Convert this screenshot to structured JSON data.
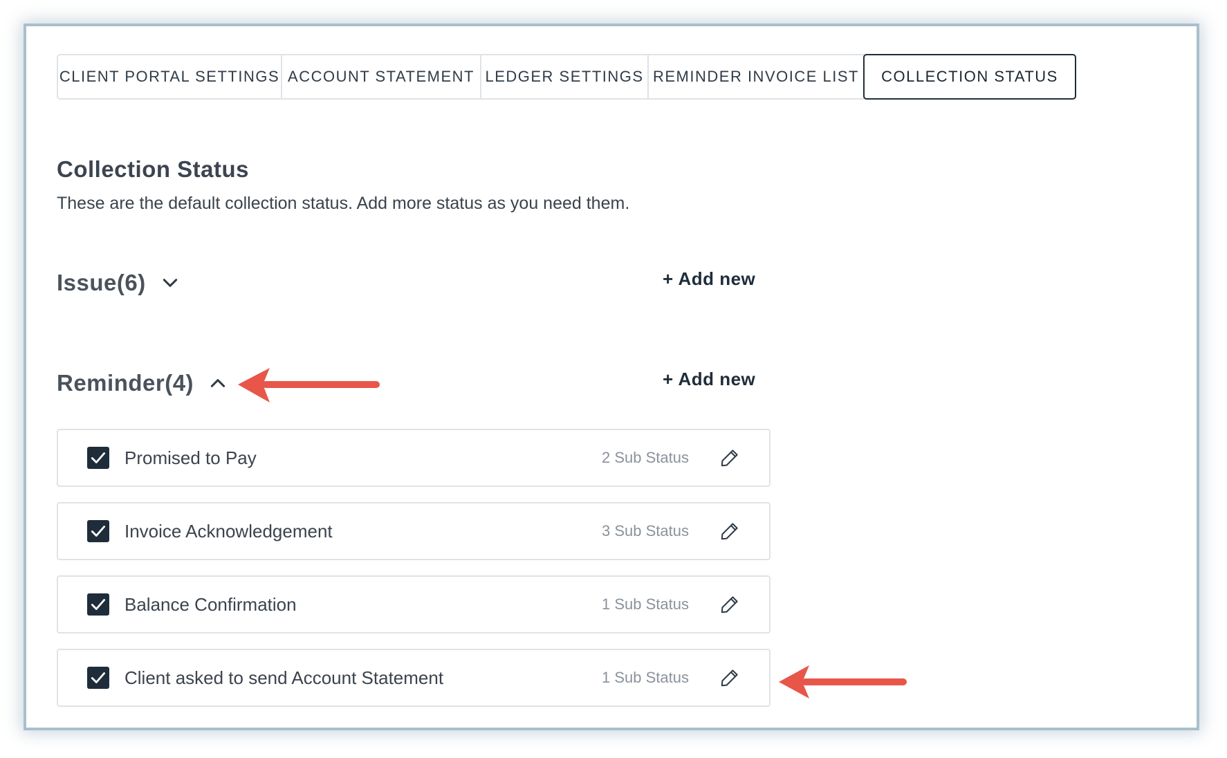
{
  "tabs": [
    {
      "label": "CLIENT PORTAL SETTINGS",
      "active": false
    },
    {
      "label": "ACCOUNT STATEMENT",
      "active": false
    },
    {
      "label": "LEDGER SETTINGS",
      "active": false
    },
    {
      "label": "REMINDER INVOICE LIST",
      "active": false
    },
    {
      "label": "COLLECTION STATUS",
      "active": true
    }
  ],
  "page": {
    "title": "Collection Status",
    "subtitle": "These are the default collection status. Add more status as you need them."
  },
  "groups": {
    "issue": {
      "label": "Issue(6)",
      "add_label": "+ Add new",
      "expanded": false
    },
    "reminder": {
      "label": "Reminder(4)",
      "add_label": "+ Add new",
      "expanded": true
    }
  },
  "reminder_items": [
    {
      "label": "Promised to Pay",
      "sub_status": "2 Sub Status",
      "checked": true
    },
    {
      "label": "Invoice Acknowledgement",
      "sub_status": "3 Sub Status",
      "checked": true
    },
    {
      "label": "Balance Confirmation",
      "sub_status": "1 Sub Status",
      "checked": true
    },
    {
      "label": "Client asked to send Account Statement",
      "sub_status": "1 Sub Status",
      "checked": true
    }
  ],
  "colors": {
    "accent": "#1f2d3a",
    "frame_border": "#a9bfcc",
    "annotation_arrow": "#e8564a"
  },
  "icons": {
    "checkbox": "checkmark-icon",
    "edit": "pencil-icon",
    "collapsed": "chevron-down-icon",
    "expanded": "chevron-up-icon",
    "annotation": "arrow-left-icon"
  }
}
